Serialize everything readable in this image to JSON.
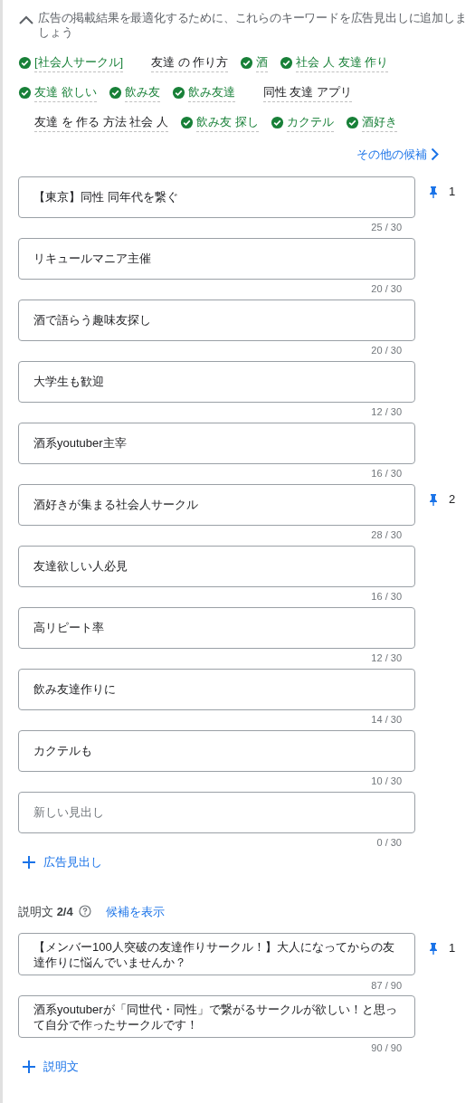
{
  "suggestions": {
    "expanded": true,
    "message": "広告の掲載結果を最適化するために、これらのキーワードを広告見出しに追加しましょう",
    "keyword_rows": [
      [
        {
          "text": "[社会人サークル]",
          "added": true
        },
        {
          "text": "友達 の 作り方",
          "added": false
        },
        {
          "text": "酒",
          "added": true
        },
        {
          "text": "社会 人 友達 作り",
          "added": true
        }
      ],
      [
        {
          "text": "友達 欲しい",
          "added": true
        },
        {
          "text": "飲み友",
          "added": true
        },
        {
          "text": "飲み友達",
          "added": true
        },
        {
          "text": "同性 友達 アプリ",
          "added": false
        }
      ],
      [
        {
          "text": "友達 を 作る 方法 社会 人",
          "added": false
        },
        {
          "text": "飲み友 探し",
          "added": true
        },
        {
          "text": "カクテル",
          "added": true
        },
        {
          "text": "酒好き",
          "added": true
        }
      ]
    ],
    "more_link": "その他の候補"
  },
  "headlines": [
    {
      "value": "【東京】同性 同年代を繋ぐ",
      "counter": "25 / 30",
      "pin": "1"
    },
    {
      "value": "リキュールマニア主催",
      "counter": "20 / 30"
    },
    {
      "value": "酒で語らう趣味友探し",
      "counter": "20 / 30"
    },
    {
      "value": "大学生も歓迎",
      "counter": "12 / 30"
    },
    {
      "value": "酒系youtuber主宰",
      "counter": "16 / 30"
    },
    {
      "value": "酒好きが集まる社会人サークル",
      "counter": "28 / 30",
      "pin": "2"
    },
    {
      "value": "友達欲しい人必見",
      "counter": "16 / 30"
    },
    {
      "value": "高リピート率",
      "counter": "12 / 30"
    },
    {
      "value": "飲み友達作りに",
      "counter": "14 / 30"
    },
    {
      "value": "カクテルも",
      "counter": "10 / 30"
    },
    {
      "placeholder": "新しい見出し",
      "counter": "0 / 30"
    }
  ],
  "add_headline": "広告見出し",
  "descriptions_section": {
    "label": "説明文",
    "count": "2/4",
    "suggest_link": "候補を表示"
  },
  "descriptions": [
    {
      "value": "【メンバー100人突破の友達作りサークル！】大人になってからの友達作りに悩んでいませんか？",
      "counter": "87 / 90",
      "pin": "1"
    },
    {
      "value": "酒系youtuberが「同世代・同性」で繋がるサークルが欲しい！と思って自分で作ったサークルです！",
      "counter": "90 / 90"
    }
  ],
  "add_description": "説明文"
}
